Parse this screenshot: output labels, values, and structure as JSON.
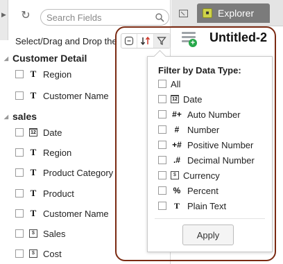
{
  "search": {
    "placeholder": "Search Fields"
  },
  "panel_hint": "Select/Drag and Drop the Fields",
  "groups": [
    {
      "label": "Customer Detail",
      "fields": [
        {
          "label": "Region",
          "type_icon": "text-type-icon",
          "glyph": "T"
        },
        {
          "label": "Customer Name",
          "type_icon": "text-type-icon",
          "glyph": "T"
        }
      ]
    },
    {
      "label": "sales",
      "fields": [
        {
          "label": "Date",
          "type_icon": "date-type-icon",
          "glyph": "12"
        },
        {
          "label": "Region",
          "type_icon": "text-type-icon",
          "glyph": "T"
        },
        {
          "label": "Product Category",
          "type_icon": "text-type-icon",
          "glyph": "T"
        },
        {
          "label": "Product",
          "type_icon": "text-type-icon",
          "glyph": "T"
        },
        {
          "label": "Customer Name",
          "type_icon": "text-type-icon",
          "glyph": "T"
        },
        {
          "label": "Sales",
          "type_icon": "currency-type-icon",
          "glyph": "$"
        },
        {
          "label": "Cost",
          "type_icon": "currency-type-icon",
          "glyph": "$"
        }
      ]
    }
  ],
  "tab": {
    "label": "Explorer"
  },
  "sheet": {
    "title": "Untitled-2"
  },
  "toolbar": {
    "buttons": [
      {
        "icon": "collapse-minus-icon"
      },
      {
        "icon": "sort-arrows-icon"
      },
      {
        "icon": "filter-funnel-icon"
      }
    ]
  },
  "filter": {
    "title": "Filter by Data Type:",
    "options": [
      {
        "label": "All",
        "icon": "",
        "glyph": ""
      },
      {
        "label": "Date",
        "icon": "date-type-icon",
        "glyph": "12"
      },
      {
        "label": "Auto Number",
        "icon": "auto-number-type-icon",
        "glyph": "#+"
      },
      {
        "label": "Number",
        "icon": "number-type-icon",
        "glyph": "#"
      },
      {
        "label": "Positive Number",
        "icon": "positive-number-type-icon",
        "glyph": "+#"
      },
      {
        "label": "Decimal Number",
        "icon": "decimal-number-type-icon",
        "glyph": ".#"
      },
      {
        "label": "Currency",
        "icon": "currency-type-icon",
        "glyph": "$"
      },
      {
        "label": "Percent",
        "icon": "percent-type-icon",
        "glyph": "%"
      },
      {
        "label": "Plain Text",
        "icon": "plain-text-type-icon",
        "glyph": "T"
      }
    ],
    "apply_label": "Apply"
  },
  "colors": {
    "highlight_ring": "#7a2a12",
    "sort_arrow_red": "#d0392b",
    "add_sheet_green": "#27a84a",
    "explorer_tab_bg": "#7b7b7b"
  }
}
